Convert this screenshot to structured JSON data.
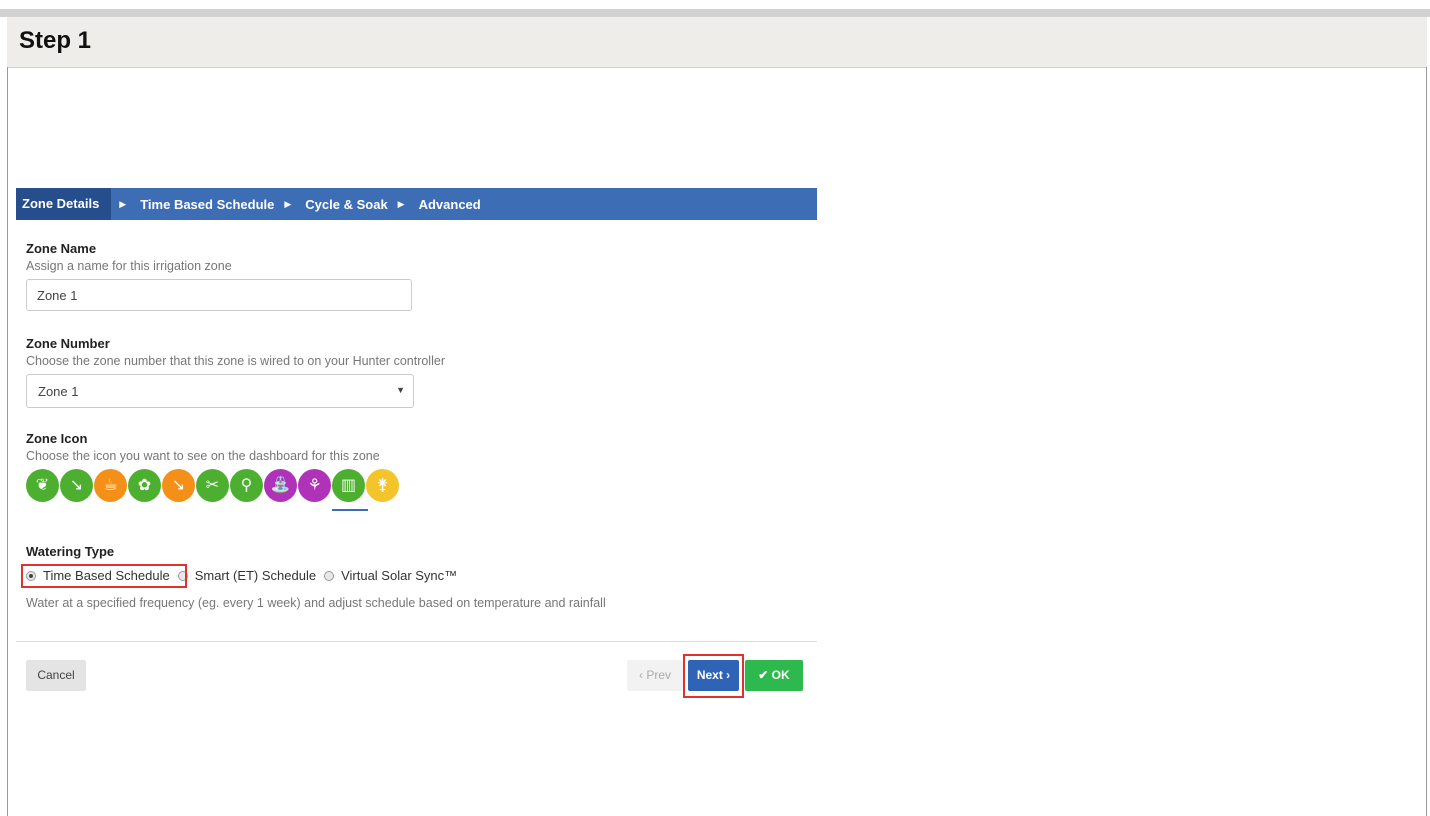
{
  "header": {
    "step_title": "Step 1"
  },
  "wizard_tabs": [
    {
      "label": "Zone Details"
    },
    {
      "label": "Time Based Schedule"
    },
    {
      "label": "Cycle & Soak"
    },
    {
      "label": "Advanced"
    }
  ],
  "active_tab": "Zone Details",
  "zone_name": {
    "label": "Zone Name",
    "help": "Assign a name for this irrigation zone",
    "value": "Zone 1"
  },
  "zone_number": {
    "label": "Zone Number",
    "help": "Choose the zone number that this zone is wired to on your Hunter controller",
    "selected": "Zone 1"
  },
  "zone_icon": {
    "label": "Zone Icon",
    "help": "Choose the icon you want to see on the dashboard for this zone",
    "icons": [
      {
        "name": "leaf-icon",
        "color": "#4caf2f",
        "glyph": "❦"
      },
      {
        "name": "hose-icon",
        "color": "#4caf2f",
        "glyph": "↘"
      },
      {
        "name": "watering-can-icon",
        "color": "#f48f18",
        "glyph": "☕"
      },
      {
        "name": "flower-icon",
        "color": "#4caf2f",
        "glyph": "✿"
      },
      {
        "name": "rake-icon",
        "color": "#f48f18",
        "glyph": "↘"
      },
      {
        "name": "shears-icon",
        "color": "#4caf2f",
        "glyph": "✂"
      },
      {
        "name": "shovel-icon",
        "color": "#4caf2f",
        "glyph": "⚲"
      },
      {
        "name": "sprayer-icon",
        "color": "#b032b8",
        "glyph": "⛲"
      },
      {
        "name": "sprout-icon",
        "color": "#b032b8",
        "glyph": "⚘"
      },
      {
        "name": "grass-icon",
        "color": "#4caf2f",
        "glyph": "▥",
        "selected": true
      },
      {
        "name": "tree-icon",
        "color": "#f4c52a",
        "glyph": "⚵"
      }
    ]
  },
  "watering_type": {
    "label": "Watering Type",
    "options": [
      {
        "label": "Time Based Schedule",
        "checked": true
      },
      {
        "label": "Smart (ET) Schedule",
        "checked": false
      },
      {
        "label": "Virtual Solar Sync™",
        "checked": false
      }
    ],
    "description": "Water at a specified frequency (eg. every 1 week) and adjust schedule based on temperature and rainfall"
  },
  "buttons": {
    "cancel": "Cancel",
    "prev": "‹ Prev",
    "next": "Next ›",
    "ok": "✔ OK"
  },
  "colors": {
    "nav_bg": "#3d6db5",
    "nav_active": "#264d8c",
    "next_btn": "#2f63b5",
    "ok_btn": "#2db94d",
    "highlight": "#e0312e"
  }
}
